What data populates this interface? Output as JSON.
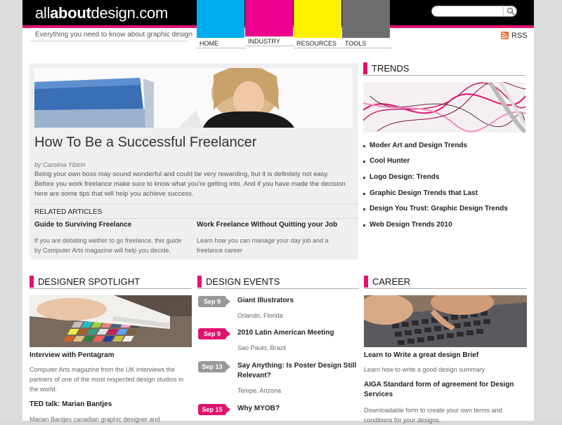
{
  "header": {
    "logo_prefix": "all",
    "logo_bold": "about",
    "logo_suffix": "design.com",
    "tagline": "Everything you need to know about graphic design",
    "search_placeholder": "",
    "rss_label": "RSS"
  },
  "nav": [
    {
      "label": "HOME",
      "color": "#00aeef"
    },
    {
      "label": "INDUSTRY",
      "color": "#ec008c"
    },
    {
      "label": "RESOURCES",
      "color": "#fff200"
    },
    {
      "label": "TOOLS",
      "color": "#6d6e70"
    }
  ],
  "feature": {
    "title": "How To Be a Successful Freelancer",
    "author": "by Carolina Yibirin",
    "text": "Being your own boss may sound wonderful and could be very rewarding, but it is definitely not easy. Before you work freelance make sure to know what you're getting into. And if you have made the decision here are some tips that will help you achieve success.",
    "related_heading": "RELATED ARTICLES",
    "related": [
      {
        "title": "Guide to Surviving Freelance",
        "desc": "If you are debating wether to go freelance, this guide by Computer Arts magazine will help you decide."
      },
      {
        "title": "Work Freelance Without Quitting your Job",
        "desc": "Learn how you can manage your day job and a freelance career"
      }
    ]
  },
  "trends": {
    "heading": "TRENDS",
    "items": [
      "Moder Art and Design Trends",
      "Cool Hunter",
      "Logo Design: Trends",
      "Graphic Design Trends that Last",
      "Design You Trust: Graphic Design Trends",
      "Web Design Trends 2010"
    ]
  },
  "spotlight": {
    "heading": "DESIGNER SPOTLIGHT",
    "items": [
      {
        "title": "Interview with Pentagram",
        "desc": "Computer Arts magazine from the UK interviews the partners of one of the most respected design studios in the world."
      },
      {
        "title": "TED talk: Marian Bantjes",
        "desc": "Marian Bantjes canadian graphic designer and"
      }
    ]
  },
  "events": {
    "heading": "DESIGN EVENTS",
    "items": [
      {
        "date": "Sep 9",
        "style": "grey",
        "title": "Giant Illustrators",
        "location": "Orlando, Florida"
      },
      {
        "date": "Sep 9",
        "style": "pink",
        "title": "2010 Latin American Meeting",
        "location": "Sao Paulo, Brazil"
      },
      {
        "date": "Sep 13",
        "style": "grey",
        "title": "Say Anything: Is Poster Design Still Relevant?",
        "location": "Tempe, Arizona"
      },
      {
        "date": "Sep 15",
        "style": "pink",
        "title": "Why MYOB?",
        "location": ""
      }
    ]
  },
  "career": {
    "heading": "CAREER",
    "items": [
      {
        "title": "Learn to Write a great design Brief",
        "desc": "Learn how to write a good design summary"
      },
      {
        "title": "AIGA Standard form of agreement for Design Services",
        "desc": "Downloadable form to create your own terms and conditions for your designs."
      }
    ]
  },
  "colors": {
    "accent": "#e0126e",
    "rss": "#f26522"
  }
}
